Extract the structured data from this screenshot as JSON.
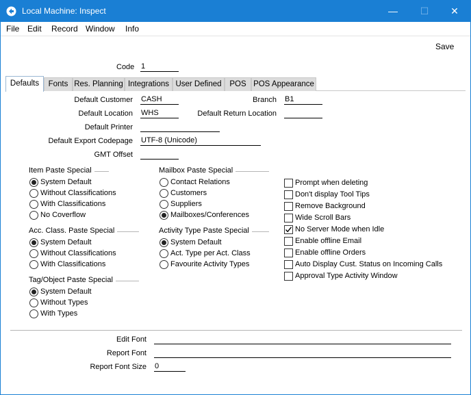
{
  "window": {
    "title": "Local Machine: Inspect",
    "min_glyph": "—",
    "max_glyph": "☐",
    "close_glyph": "✕"
  },
  "menu": {
    "file": "File",
    "edit": "Edit",
    "record": "Record",
    "window": "Window",
    "info": "Info"
  },
  "toolbar": {
    "save_label": "Save"
  },
  "header": {
    "code_label": "Code",
    "code_value": "1"
  },
  "tabs": {
    "defaults": "Defaults",
    "fonts": "Fonts",
    "res_planning": "Res. Planning",
    "integrations": "Integrations",
    "user_defined": "User Defined",
    "pos": "POS",
    "pos_appearance": "POS Appearance"
  },
  "form": {
    "default_customer_label": "Default Customer",
    "default_customer_value": "CASH",
    "branch_label": "Branch",
    "branch_value": "B1",
    "default_location_label": "Default Location",
    "default_location_value": "WHS",
    "default_return_location_label": "Default Return Location",
    "default_return_location_value": "",
    "default_printer_label": "Default Printer",
    "default_printer_value": "",
    "default_export_codepage_label": "Default Export Codepage",
    "default_export_codepage_value": "UTF-8 (Unicode)",
    "gmt_offset_label": "GMT Offset",
    "gmt_offset_value": ""
  },
  "item_paste": {
    "title": "Item Paste Special",
    "options": [
      "System Default",
      "Without Classifications",
      "With Classifications",
      "No Coverflow"
    ],
    "selected": "System Default"
  },
  "mailbox_paste": {
    "title": "Mailbox Paste Special",
    "options": [
      "Contact Relations",
      "Customers",
      "Suppliers",
      "Mailboxes/Conferences"
    ],
    "selected": "Mailboxes/Conferences"
  },
  "acc_class_paste": {
    "title": "Acc. Class. Paste Special",
    "options": [
      "System Default",
      "Without Classifications",
      "With Classifications"
    ],
    "selected": "System Default"
  },
  "activity_type_paste": {
    "title": "Activity Type Paste Special",
    "options": [
      "System Default",
      "Act. Type per Act. Class",
      "Favourite Activity Types"
    ],
    "selected": "System Default"
  },
  "tag_object_paste": {
    "title": "Tag/Object Paste Special",
    "options": [
      "System Default",
      "Without Types",
      "With Types"
    ],
    "selected": "System Default"
  },
  "checkboxes": [
    {
      "label": "Prompt when deleting",
      "checked": false
    },
    {
      "label": "Don't display Tool Tips",
      "checked": false
    },
    {
      "label": "Remove Background",
      "checked": false
    },
    {
      "label": "Wide Scroll Bars",
      "checked": false
    },
    {
      "label": "No Server Mode when Idle",
      "checked": true
    },
    {
      "label": "Enable offline Email",
      "checked": false
    },
    {
      "label": "Enable offline Orders",
      "checked": false
    },
    {
      "label": "Auto Display Cust. Status on Incoming Calls",
      "checked": false
    },
    {
      "label": "Approval Type Activity Window",
      "checked": false
    }
  ],
  "fonts": {
    "edit_font_label": "Edit Font",
    "edit_font_value": "",
    "report_font_label": "Report Font",
    "report_font_value": "",
    "report_font_size_label": "Report Font Size",
    "report_font_size_value": "0"
  },
  "colors": {
    "titlebar": "#1a7fd4",
    "tab_inactive": "#dcdcdc"
  }
}
